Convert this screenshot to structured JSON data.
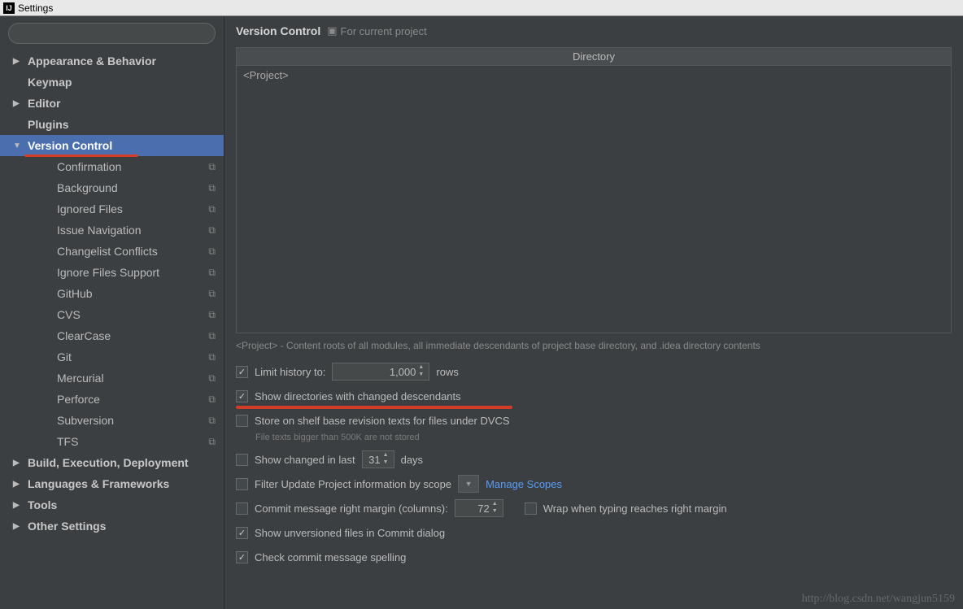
{
  "window": {
    "title": "Settings"
  },
  "search": {
    "placeholder": ""
  },
  "sidebar": {
    "items": [
      {
        "label": "Appearance & Behavior",
        "level": 0,
        "arrow": "right",
        "copy": false
      },
      {
        "label": "Keymap",
        "level": 0,
        "arrow": "none",
        "copy": false
      },
      {
        "label": "Editor",
        "level": 0,
        "arrow": "right",
        "copy": false
      },
      {
        "label": "Plugins",
        "level": 0,
        "arrow": "none",
        "copy": false
      },
      {
        "label": "Version Control",
        "level": 0,
        "arrow": "down",
        "copy": false,
        "selected": true,
        "underline": true
      },
      {
        "label": "Confirmation",
        "level": 1,
        "arrow": "none",
        "copy": true
      },
      {
        "label": "Background",
        "level": 1,
        "arrow": "none",
        "copy": true
      },
      {
        "label": "Ignored Files",
        "level": 1,
        "arrow": "none",
        "copy": true
      },
      {
        "label": "Issue Navigation",
        "level": 1,
        "arrow": "none",
        "copy": true
      },
      {
        "label": "Changelist Conflicts",
        "level": 1,
        "arrow": "none",
        "copy": true
      },
      {
        "label": "Ignore Files Support",
        "level": 1,
        "arrow": "none",
        "copy": true
      },
      {
        "label": "GitHub",
        "level": 1,
        "arrow": "none",
        "copy": true
      },
      {
        "label": "CVS",
        "level": 1,
        "arrow": "none",
        "copy": true
      },
      {
        "label": "ClearCase",
        "level": 1,
        "arrow": "none",
        "copy": true
      },
      {
        "label": "Git",
        "level": 1,
        "arrow": "none",
        "copy": true
      },
      {
        "label": "Mercurial",
        "level": 1,
        "arrow": "none",
        "copy": true
      },
      {
        "label": "Perforce",
        "level": 1,
        "arrow": "none",
        "copy": true
      },
      {
        "label": "Subversion",
        "level": 1,
        "arrow": "none",
        "copy": true
      },
      {
        "label": "TFS",
        "level": 1,
        "arrow": "none",
        "copy": true
      },
      {
        "label": "Build, Execution, Deployment",
        "level": 0,
        "arrow": "right",
        "copy": false
      },
      {
        "label": "Languages & Frameworks",
        "level": 0,
        "arrow": "right",
        "copy": false
      },
      {
        "label": "Tools",
        "level": 0,
        "arrow": "right",
        "copy": false
      },
      {
        "label": "Other Settings",
        "level": 0,
        "arrow": "right",
        "copy": false
      }
    ]
  },
  "breadcrumb": {
    "title": "Version Control",
    "sub": "For current project"
  },
  "directory": {
    "header": "Directory",
    "row": "<Project>"
  },
  "desc": "<Project> - Content roots of all modules, all immediate descendants of project base directory, and .idea directory contents",
  "options": {
    "limit_label": "Limit history to:",
    "limit_value": "1,000",
    "limit_suffix": "rows",
    "show_dirs": "Show directories with changed descendants",
    "store_shelf": "Store on shelf base revision texts for files under DVCS",
    "store_hint": "File texts bigger than 500K are not stored",
    "show_changed_prefix": "Show changed in last",
    "show_changed_value": "31",
    "show_changed_suffix": "days",
    "filter_scope": "Filter Update Project information by scope",
    "manage_scopes": "Manage Scopes",
    "commit_margin": "Commit message right margin (columns):",
    "commit_margin_value": "72",
    "wrap_margin": "Wrap when typing reaches right margin",
    "show_unversioned": "Show unversioned files in Commit dialog",
    "check_spelling": "Check commit message spelling"
  },
  "watermark": "http://blog.csdn.net/wangjun5159"
}
